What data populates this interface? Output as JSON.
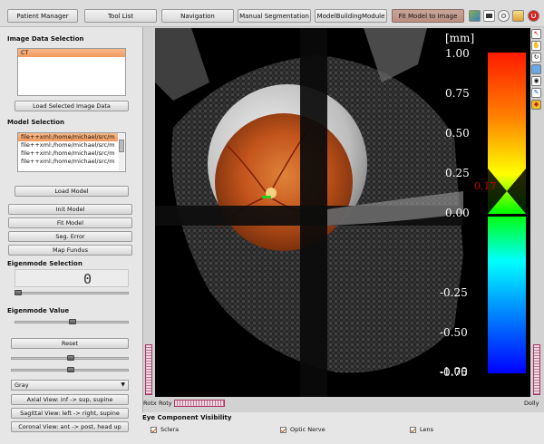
{
  "tabs": [
    {
      "label": "Patient Manager"
    },
    {
      "label": "Tool List"
    },
    {
      "label": "Navigation"
    },
    {
      "label": "Manual Segmentation"
    },
    {
      "label": "ModelBuildingModule"
    },
    {
      "label": "Fit Model to Image"
    }
  ],
  "toolbar_icons": [
    "image-icon",
    "film-icon",
    "gear-icon",
    "pencil-icon",
    "power-icon"
  ],
  "image_data": {
    "title": "Image Data Selection",
    "items": [
      "CT"
    ],
    "load_button": "Load Selected Image Data"
  },
  "model_selection": {
    "title": "Model Selection",
    "items": [
      "file++xml:/home/michael/src/m",
      "file++xml:/home/michael/src/m",
      "file++xml:/home/michael/src/m",
      "file++xml:/home/michael/src/m"
    ],
    "load_button": "Load Model"
  },
  "actions": {
    "init_model": "Init Model",
    "fit_model": "Fit Model",
    "seg_error": "Seg. Error",
    "map_fundus": "Map Fundus"
  },
  "eigenmode": {
    "selection_title": "Eigenmode Selection",
    "selection_value": "0",
    "value_title": "Eigenmode Value",
    "reset_button": "Reset"
  },
  "colormap": {
    "selected": "Gray"
  },
  "views": {
    "axial": "Axial View: inf -> sup, supine",
    "sagittal": "Sagittal View: left -> right, supine",
    "coronal": "Coronal View: ant -> post, head up"
  },
  "colorbar": {
    "unit": "[mm]",
    "ticks": [
      "1.00",
      "0.75",
      "0.50",
      "0.25",
      "0.00",
      "-0.25",
      "-0.50",
      "-0.75",
      "-1.00"
    ],
    "marker_value": "0.17",
    "marker_color": "#d00000"
  },
  "side_tools": [
    "pointer-icon",
    "hand-icon",
    "rotate-icon",
    "zoom-icon",
    "eye-icon",
    "pen-icon",
    "shield-icon"
  ],
  "wheels": {
    "rotx": "Rotx",
    "roty": "Roty",
    "dolly": "Dolly"
  },
  "visibility": {
    "title": "Eye Component Visibility",
    "items": [
      "Sclera",
      "Optic Nerve",
      "Lens"
    ]
  }
}
